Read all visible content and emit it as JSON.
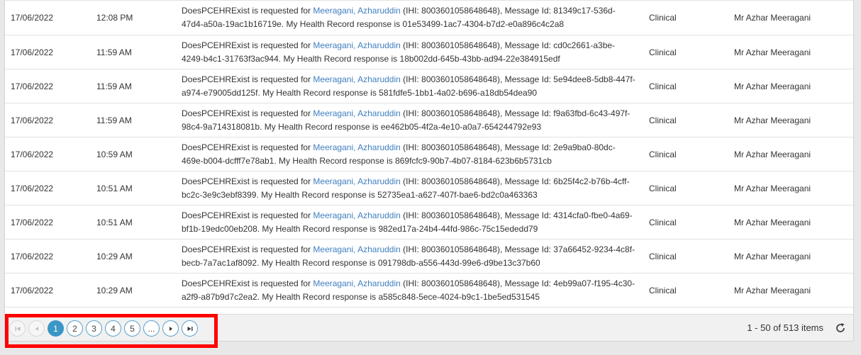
{
  "rows": [
    {
      "date": "17/06/2022",
      "time": "12:08 PM",
      "msg_pre": "DoesPCEHRExist is requested for ",
      "patient": "Meeragani, Azharuddin",
      "msg_post": " (IHI: 8003601058648648), Message Id: 81349c17-536d-47d4-a50a-19ac1b16719e. My Health Record response is 01e53499-1ac7-4304-b7d2-e0a896c4c2a8",
      "category": "Clinical",
      "user": "Mr Azhar Meeragani"
    },
    {
      "date": "17/06/2022",
      "time": "11:59 AM",
      "msg_pre": "DoesPCEHRExist is requested for ",
      "patient": "Meeragani, Azharuddin",
      "msg_post": " (IHI: 8003601058648648), Message Id: cd0c2661-a3be-4249-b4c1-31763f3ac944. My Health Record response is 18b002dd-645b-43bb-ad94-22e384915edf",
      "category": "Clinical",
      "user": "Mr Azhar Meeragani"
    },
    {
      "date": "17/06/2022",
      "time": "11:59 AM",
      "msg_pre": "DoesPCEHRExist is requested for ",
      "patient": "Meeragani, Azharuddin",
      "msg_post": " (IHI: 8003601058648648), Message Id: 5e94dee8-5db8-447f-a974-e79005dd125f. My Health Record response is 581fdfe5-1bb1-4a02-b696-a18db54dea90",
      "category": "Clinical",
      "user": "Mr Azhar Meeragani"
    },
    {
      "date": "17/06/2022",
      "time": "11:59 AM",
      "msg_pre": "DoesPCEHRExist is requested for ",
      "patient": "Meeragani, Azharuddin",
      "msg_post": " (IHI: 8003601058648648), Message Id: f9a63fbd-6c43-497f-98c4-9a714318081b. My Health Record response is ee462b05-4f2a-4e10-a0a7-654244792e93",
      "category": "Clinical",
      "user": "Mr Azhar Meeragani"
    },
    {
      "date": "17/06/2022",
      "time": "10:59 AM",
      "msg_pre": "DoesPCEHRExist is requested for ",
      "patient": "Meeragani, Azharuddin",
      "msg_post": " (IHI: 8003601058648648), Message Id: 2e9a9ba0-80dc-469e-b004-dcfff7e78ab1. My Health Record response is 869fcfc9-90b7-4b07-8184-623b6b5731cb",
      "category": "Clinical",
      "user": "Mr Azhar Meeragani"
    },
    {
      "date": "17/06/2022",
      "time": "10:51 AM",
      "msg_pre": "DoesPCEHRExist is requested for ",
      "patient": "Meeragani, Azharuddin",
      "msg_post": " (IHI: 8003601058648648), Message Id: 6b25f4c2-b76b-4cff-bc2c-3e9c3ebf8399. My Health Record response is 52735ea1-a627-407f-bae6-bd2c0a463363",
      "category": "Clinical",
      "user": "Mr Azhar Meeragani"
    },
    {
      "date": "17/06/2022",
      "time": "10:51 AM",
      "msg_pre": "DoesPCEHRExist is requested for ",
      "patient": "Meeragani, Azharuddin",
      "msg_post": " (IHI: 8003601058648648), Message Id: 4314cfa0-fbe0-4a69-bf1b-19edc00eb208. My Health Record response is 982ed17a-24b4-44fd-986c-75c15ededd79",
      "category": "Clinical",
      "user": "Mr Azhar Meeragani"
    },
    {
      "date": "17/06/2022",
      "time": "10:29 AM",
      "msg_pre": "DoesPCEHRExist is requested for ",
      "patient": "Meeragani, Azharuddin",
      "msg_post": " (IHI: 8003601058648648), Message Id: 37a66452-9234-4c8f-becb-7a7ac1af8092. My Health Record response is 091798db-a556-443d-99e6-d9be13c37b60",
      "category": "Clinical",
      "user": "Mr Azhar Meeragani"
    },
    {
      "date": "17/06/2022",
      "time": "10:29 AM",
      "msg_pre": "DoesPCEHRExist is requested for ",
      "patient": "Meeragani, Azharuddin",
      "msg_post": " (IHI: 8003601058648648), Message Id: 4eb99a07-f195-4c30-a2f9-a87b9d7c2ea2. My Health Record response is a585c848-5ece-4024-b9c1-1be5ed531545",
      "category": "Clinical",
      "user": "Mr Azhar Meeragani"
    }
  ],
  "pager": {
    "first_icon": "first-page-icon",
    "prev_icon": "previous-page-icon",
    "pages": [
      "1",
      "2",
      "3",
      "4",
      "5"
    ],
    "active_page": "1",
    "ellipsis": "...",
    "next_icon": "next-page-icon",
    "last_icon": "last-page-icon",
    "items_info": "1 - 50 of 513 items",
    "refresh_icon": "refresh-icon"
  },
  "colors": {
    "link": "#3f7fbf",
    "active_page": "#3a96c6",
    "highlight": "#ff0000"
  }
}
